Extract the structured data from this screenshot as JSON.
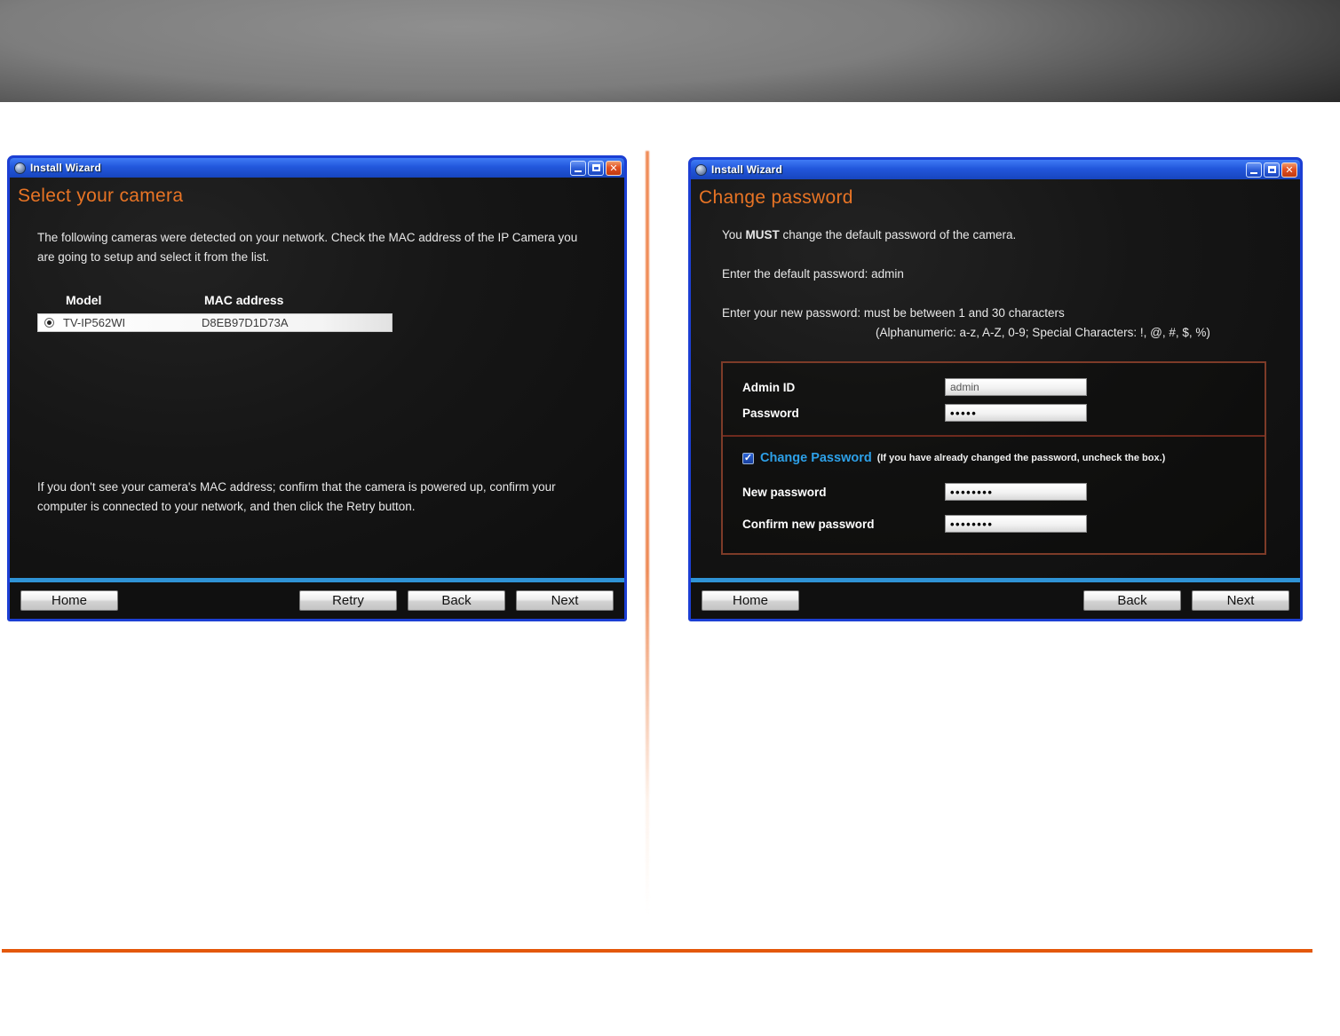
{
  "colors": {
    "accent_orange": "#e87425",
    "page_divider_orange": "#e4580a",
    "titlebar_blue": "#2257dc",
    "button_bar_divider_blue": "#2f93d6",
    "change_password_link_blue": "#2da0e8",
    "form_box_border": "#7d3b28"
  },
  "left_window": {
    "title": "Install Wizard",
    "heading": "Select your camera",
    "intro": "The following cameras were detected on your network. Check the MAC address of the IP Camera you are going to setup and select it from the list.",
    "table": {
      "columns": [
        "Model",
        "MAC address"
      ],
      "rows": [
        {
          "model": "TV-IP562WI",
          "mac": "D8EB97D1D73A",
          "selected": true
        }
      ]
    },
    "note": "If you don't see your camera's MAC address; confirm that the camera is powered up, confirm your computer is connected to your network, and then click the Retry button.",
    "buttons": {
      "home": "Home",
      "retry": "Retry",
      "back": "Back",
      "next": "Next"
    }
  },
  "right_window": {
    "title": "Install Wizard",
    "heading": "Change password",
    "must_line": {
      "pre": "You ",
      "bold": "MUST",
      "post": " change the default password of the camera."
    },
    "default_password_line": "Enter the default password: admin",
    "new_password_line1": "Enter your new password: must be between 1 and 30 characters",
    "new_password_line2": "(Alphanumeric: a-z, A-Z, 0-9; Special Characters: !, @, #, $, %)",
    "form": {
      "admin_id_label": "Admin ID",
      "admin_id_value": "admin",
      "password_label": "Password",
      "password_value": "•••••",
      "change_password_label": "Change Password",
      "change_password_checked": "✓",
      "change_password_hint": "(If you have already changed the password, uncheck the box.)",
      "new_password_label": "New password",
      "new_password_value": "••••••••",
      "confirm_label": "Confirm new password",
      "confirm_value": "••••••••"
    },
    "buttons": {
      "home": "Home",
      "back": "Back",
      "next": "Next"
    }
  }
}
